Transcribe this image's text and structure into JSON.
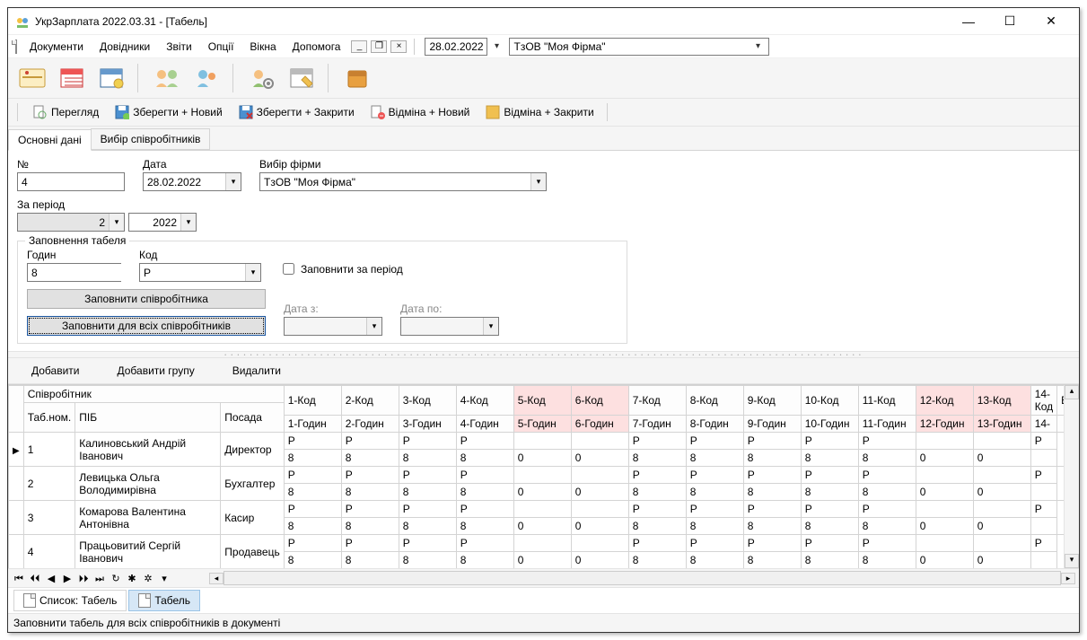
{
  "window": {
    "title": "УкрЗарплата 2022.03.31 - [Табель]"
  },
  "menu": {
    "documents": "Документи",
    "directories": "Довідники",
    "reports": "Звіти",
    "options": "Опції",
    "windows": "Вікна",
    "help": "Допомога",
    "date": "28.02.2022",
    "firm": "ТзОВ \"Моя Фірма\""
  },
  "doctoolbar": {
    "preview": "Перегляд",
    "save_new": "Зберегти + Новий",
    "save_close": "Зберегти + Закрити",
    "cancel_new": "Відміна + Новий",
    "cancel_close": "Відміна + Закрити"
  },
  "tabs": {
    "main": "Основні дані",
    "emp": "Вибір співробітників"
  },
  "form": {
    "num_label": "№",
    "num": "4",
    "date_label": "Дата",
    "date": "28.02.2022",
    "firm_label": "Вибір фірми",
    "firm": "ТзОВ \"Моя Фірма\"",
    "period_label": "За період",
    "month": "2",
    "year": "2022",
    "fill_legend": "Заповнення табеля",
    "hours_label": "Годин",
    "hours": "8",
    "code_label": "Код",
    "code": "Р",
    "fill_period": "Заповнити за період",
    "date_from": "Дата з:",
    "date_to": "Дата по:",
    "fill_emp": "Заповнити співробітника",
    "fill_all": "Заповнити для всіх співробітників"
  },
  "gridbar": {
    "add": "Добавити",
    "add_group": "Добавити групу",
    "delete": "Видалити"
  },
  "gridhead": {
    "band": "Співробітник",
    "tabnum": "Таб.ном.",
    "pib": "ПІБ",
    "posada": "Посада",
    "vi": "Ві",
    "day_cols": [
      {
        "code": "1-Код",
        "hours": "1-Годин",
        "weekend": false
      },
      {
        "code": "2-Код",
        "hours": "2-Годин",
        "weekend": false
      },
      {
        "code": "3-Код",
        "hours": "3-Годин",
        "weekend": false
      },
      {
        "code": "4-Код",
        "hours": "4-Годин",
        "weekend": false
      },
      {
        "code": "5-Код",
        "hours": "5-Годин",
        "weekend": true
      },
      {
        "code": "6-Код",
        "hours": "6-Годин",
        "weekend": true
      },
      {
        "code": "7-Код",
        "hours": "7-Годин",
        "weekend": false
      },
      {
        "code": "8-Код",
        "hours": "8-Годин",
        "weekend": false
      },
      {
        "code": "9-Код",
        "hours": "9-Годин",
        "weekend": false
      },
      {
        "code": "10-Код",
        "hours": "10-Годин",
        "weekend": false
      },
      {
        "code": "11-Код",
        "hours": "11-Годин",
        "weekend": false
      },
      {
        "code": "12-Код",
        "hours": "12-Годин",
        "weekend": true
      },
      {
        "code": "13-Код",
        "hours": "13-Годин",
        "weekend": true
      },
      {
        "code": "14-Код",
        "hours": "14-",
        "weekend": false
      }
    ]
  },
  "rows": [
    {
      "num": "1",
      "pib": "Калиновський Андрій Іванович",
      "pos": "Директор",
      "days": [
        {
          "c": "Р",
          "h": "8"
        },
        {
          "c": "Р",
          "h": "8"
        },
        {
          "c": "Р",
          "h": "8"
        },
        {
          "c": "Р",
          "h": "8"
        },
        {
          "c": "",
          "h": "0"
        },
        {
          "c": "",
          "h": "0"
        },
        {
          "c": "Р",
          "h": "8"
        },
        {
          "c": "Р",
          "h": "8"
        },
        {
          "c": "Р",
          "h": "8"
        },
        {
          "c": "Р",
          "h": "8"
        },
        {
          "c": "Р",
          "h": "8"
        },
        {
          "c": "",
          "h": "0"
        },
        {
          "c": "",
          "h": "0"
        },
        {
          "c": "Р",
          "h": ""
        }
      ]
    },
    {
      "num": "2",
      "pib": "Левицька Ольга Володимирівна",
      "pos": "Бухгалтер",
      "days": [
        {
          "c": "Р",
          "h": "8"
        },
        {
          "c": "Р",
          "h": "8"
        },
        {
          "c": "Р",
          "h": "8"
        },
        {
          "c": "Р",
          "h": "8"
        },
        {
          "c": "",
          "h": "0"
        },
        {
          "c": "",
          "h": "0"
        },
        {
          "c": "Р",
          "h": "8"
        },
        {
          "c": "Р",
          "h": "8"
        },
        {
          "c": "Р",
          "h": "8"
        },
        {
          "c": "Р",
          "h": "8"
        },
        {
          "c": "Р",
          "h": "8"
        },
        {
          "c": "",
          "h": "0"
        },
        {
          "c": "",
          "h": "0"
        },
        {
          "c": "Р",
          "h": ""
        }
      ]
    },
    {
      "num": "3",
      "pib": "Комарова Валентина Антонівна",
      "pos": "Касир",
      "days": [
        {
          "c": "Р",
          "h": "8"
        },
        {
          "c": "Р",
          "h": "8"
        },
        {
          "c": "Р",
          "h": "8"
        },
        {
          "c": "Р",
          "h": "8"
        },
        {
          "c": "",
          "h": "0"
        },
        {
          "c": "",
          "h": "0"
        },
        {
          "c": "Р",
          "h": "8"
        },
        {
          "c": "Р",
          "h": "8"
        },
        {
          "c": "Р",
          "h": "8"
        },
        {
          "c": "Р",
          "h": "8"
        },
        {
          "c": "Р",
          "h": "8"
        },
        {
          "c": "",
          "h": "0"
        },
        {
          "c": "",
          "h": "0"
        },
        {
          "c": "Р",
          "h": ""
        }
      ]
    },
    {
      "num": "4",
      "pib": "Працьовитий Сергій Іванович",
      "pos": "Продавець",
      "days": [
        {
          "c": "Р",
          "h": "8"
        },
        {
          "c": "Р",
          "h": "8"
        },
        {
          "c": "Р",
          "h": "8"
        },
        {
          "c": "Р",
          "h": "8"
        },
        {
          "c": "",
          "h": "0"
        },
        {
          "c": "",
          "h": "0"
        },
        {
          "c": "Р",
          "h": "8"
        },
        {
          "c": "Р",
          "h": "8"
        },
        {
          "c": "Р",
          "h": "8"
        },
        {
          "c": "Р",
          "h": "8"
        },
        {
          "c": "Р",
          "h": "8"
        },
        {
          "c": "",
          "h": "0"
        },
        {
          "c": "",
          "h": "0"
        },
        {
          "c": "Р",
          "h": ""
        }
      ]
    }
  ],
  "bottom_tabs": {
    "list": "Список: Табель",
    "doc": "Табель"
  },
  "status": "Заповнити табель для всіх співробітників в документі"
}
